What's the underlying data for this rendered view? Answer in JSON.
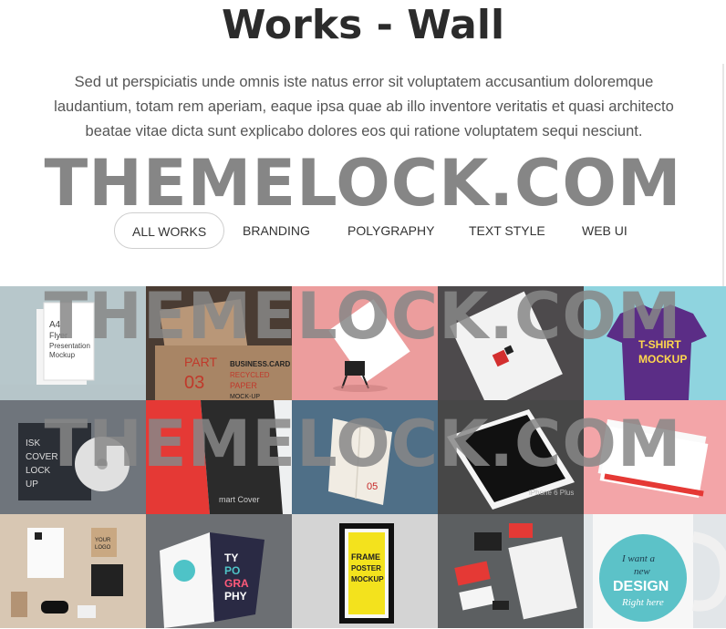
{
  "header": {
    "title": "Works - Wall",
    "intro": "Sed ut perspiciatis unde omnis iste natus error sit voluptatem accusantium doloremque laudantium, totam rem aperiam, eaque ipsa quae ab illo inventore veritatis et quasi architecto beatae vitae dicta sunt explicabo dolores eos qui ratione voluptatem sequi nesciunt."
  },
  "filters": [
    {
      "label": "ALL WORKS",
      "active": true
    },
    {
      "label": "BRANDING",
      "active": false
    },
    {
      "label": "POLYGRAPHY",
      "active": false
    },
    {
      "label": "TEXT STYLE",
      "active": false
    },
    {
      "label": "WEB UI",
      "active": false
    }
  ],
  "watermark": "THEMELOCK.COM",
  "works": [
    {
      "name": "a4-flyer-mockup",
      "text": [
        "A4",
        "Flyer",
        "Presentation",
        "Mockup"
      ],
      "bg": "#cfd8dc"
    },
    {
      "name": "business-card-mockup",
      "text": [
        "PART",
        "03",
        "BUSINESS.CARD",
        "RECYCLED",
        "PAPER",
        "MOCK-UP"
      ],
      "bg": "#5a4a3e"
    },
    {
      "name": "card-clip-mockup",
      "text": [],
      "bg": "#ef9a9a"
    },
    {
      "name": "letterhead-mockup",
      "text": [],
      "bg": "#5d5a5c"
    },
    {
      "name": "tshirt-mockup",
      "text": [
        "T-SHIRT",
        "MOCKUP"
      ],
      "bg": "#8fd3e0"
    },
    {
      "name": "cd-cover-mockup",
      "text": [
        "ISK",
        "COVER",
        "LOCK",
        "UP"
      ],
      "bg": "#3a3d44"
    },
    {
      "name": "smart-cover-mockup",
      "text": [
        "mart Cover"
      ],
      "bg": "#eceff1"
    },
    {
      "name": "folded-paper-mockup",
      "text": [
        "05"
      ],
      "bg": "#5b7a92"
    },
    {
      "name": "iphone-6-plus-mockup",
      "text": [
        "iPhone 6 Plus"
      ],
      "bg": "#5a5a5a"
    },
    {
      "name": "stacked-cards-mockup",
      "text": [],
      "bg": "#f2a3a6"
    },
    {
      "name": "stationery-set-mockup",
      "text": [
        "YOUR",
        "LOGO"
      ],
      "bg": "#d9c8b4"
    },
    {
      "name": "typography-brochure-mockup",
      "text": [
        "TY",
        "PO",
        "GRA",
        "PHY"
      ],
      "bg": "#6e7175"
    },
    {
      "name": "frame-poster-mockup",
      "text": [
        "FRAME",
        "POSTER",
        "MOCKUP"
      ],
      "bg": "#d6d6d6"
    },
    {
      "name": "branding-identity-mockup",
      "text": [],
      "bg": "#5e6163"
    },
    {
      "name": "mug-mockup",
      "text": [
        "I want a",
        "new",
        "DESIGN",
        "Right here"
      ],
      "bg": "#dfe3e6"
    }
  ]
}
